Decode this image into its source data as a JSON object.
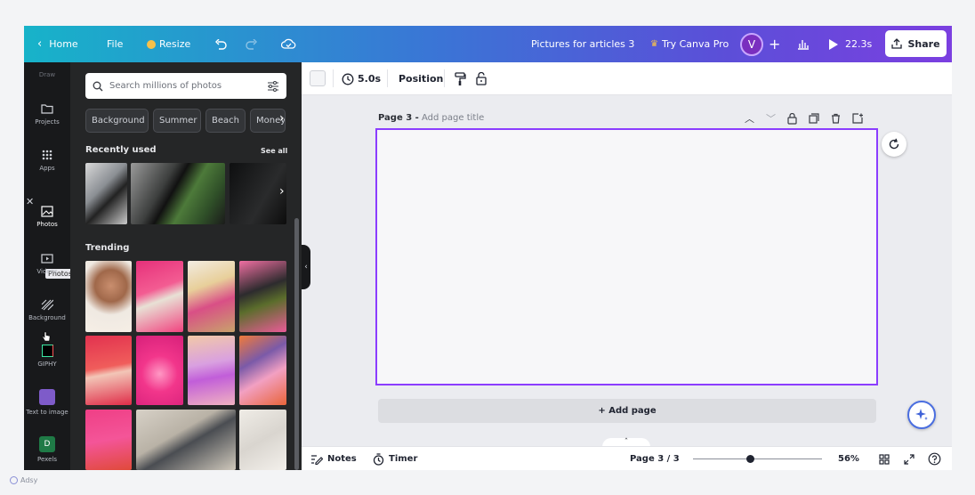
{
  "topbar": {
    "home": "Home",
    "file": "File",
    "resize": "Resize",
    "title": "Pictures for articles 3",
    "try_pro": "Try Canva Pro",
    "avatar_letter": "V",
    "duration": "22.3s",
    "share": "Share"
  },
  "rail": {
    "draw": "Draw",
    "projects": "Projects",
    "apps": "Apps",
    "photos": "Photos",
    "photos_tooltip": "Photos",
    "videos": "Videos",
    "background": "Background",
    "giphy": "GIPHY",
    "text_to_image": "Text to image",
    "pexels": "Pexels"
  },
  "panel": {
    "search_placeholder": "Search millions of photos",
    "chips": [
      "Background",
      "Summer",
      "Beach",
      "Money"
    ],
    "recently_used": "Recently used",
    "see_all": "See all",
    "trending": "Trending"
  },
  "toolbar": {
    "duration": "5.0s",
    "position": "Position"
  },
  "page": {
    "label": "Page 3 -",
    "title_placeholder": "Add page title",
    "add_page": "+ Add page"
  },
  "bottombar": {
    "notes": "Notes",
    "timer": "Timer",
    "page_indicator": "Page 3 / 3",
    "zoom": "56%"
  },
  "watermark": "Adsy",
  "colors": {
    "canvas_border": "#8b3dff",
    "panel_bg": "#252627",
    "rail_bg": "#18191b"
  }
}
